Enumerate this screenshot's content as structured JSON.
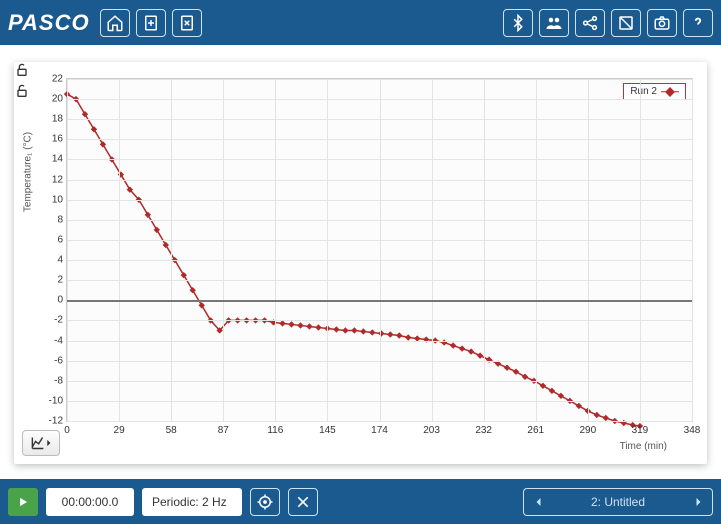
{
  "brand": "PASCO",
  "toolbar": {
    "home": "home-icon",
    "newPage": "add-page-icon",
    "deletePage": "delete-page-icon",
    "bluetooth": "bluetooth-icon",
    "class": "class-icon",
    "share": "share-icon",
    "journal": "journal-icon",
    "snapshot": "camera-icon",
    "help": "help-icon"
  },
  "chart_data": {
    "type": "line",
    "title": "",
    "xlabel": "Time (min)",
    "ylabel": "Temperature₁ (°C)",
    "xlim": [
      0,
      348
    ],
    "ylim": [
      -12,
      22
    ],
    "xticks": [
      0,
      29,
      58,
      87,
      116,
      145,
      174,
      203,
      232,
      261,
      290,
      319,
      348
    ],
    "yticks": [
      22,
      20,
      18,
      16,
      14,
      12,
      10,
      8,
      6,
      4,
      2,
      0,
      -2,
      -4,
      -6,
      -8,
      -10,
      -12
    ],
    "series": [
      {
        "name": "Run 2",
        "color": "#b02a2a",
        "x": [
          0,
          5,
          10,
          15,
          20,
          25,
          30,
          35,
          40,
          45,
          50,
          55,
          60,
          65,
          70,
          75,
          80,
          85,
          90,
          95,
          100,
          105,
          110,
          115,
          120,
          125,
          130,
          135,
          140,
          145,
          150,
          155,
          160,
          165,
          170,
          175,
          180,
          185,
          190,
          195,
          200,
          205,
          210,
          215,
          220,
          225,
          230,
          235,
          240,
          245,
          250,
          255,
          260,
          265,
          270,
          275,
          280,
          285,
          290,
          295,
          300,
          305,
          310,
          315,
          319
        ],
        "y": [
          20.5,
          20,
          18.5,
          17,
          15.5,
          14,
          12.5,
          11,
          10,
          8.5,
          7,
          5.5,
          4,
          2.5,
          1,
          -0.5,
          -2,
          -3,
          -2,
          -2,
          -2,
          -2,
          -2,
          -2.2,
          -2.3,
          -2.4,
          -2.5,
          -2.6,
          -2.7,
          -2.8,
          -2.9,
          -3,
          -3,
          -3.1,
          -3.2,
          -3.3,
          -3.4,
          -3.5,
          -3.7,
          -3.8,
          -3.9,
          -4,
          -4.2,
          -4.5,
          -4.8,
          -5.1,
          -5.5,
          -5.9,
          -6.3,
          -6.7,
          -7.1,
          -7.6,
          -8,
          -8.5,
          -9,
          -9.5,
          -10,
          -10.5,
          -11,
          -11.4,
          -11.7,
          -12,
          -12.2,
          -12.4,
          -12.5
        ]
      }
    ],
    "legend": "Run 2"
  },
  "bottombar": {
    "time": "00:00:00.0",
    "rate": "Periodic: 2 Hz",
    "runLabel": "2: Untitled"
  }
}
